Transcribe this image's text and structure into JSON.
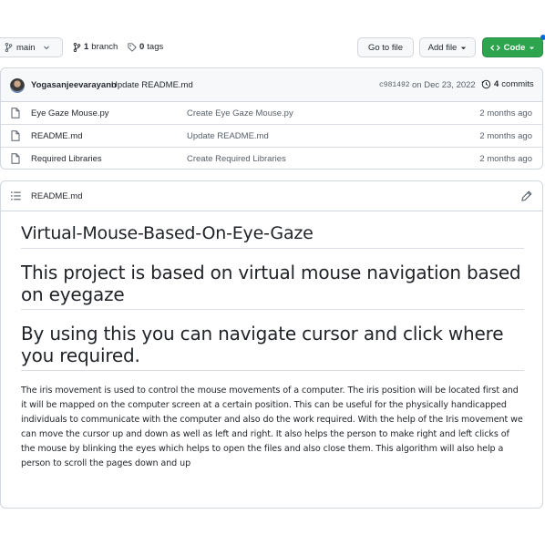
{
  "toolbar": {
    "branch_button": "main",
    "branches_count": "1",
    "branches_label": "branch",
    "tags_count": "0",
    "tags_label": "tags",
    "go_to_file": "Go to file",
    "add_file": "Add file",
    "code": "Code",
    "accent_color": "#2da44e"
  },
  "commit": {
    "author": "Yogasanjeevarayann",
    "message": "Update README.md",
    "hash": "c981492",
    "date": "on Dec 23, 2022",
    "count_number": "4",
    "count_label": "commits"
  },
  "files": [
    {
      "name": "Eye Gaze Mouse.py",
      "commit": "Create Eye Gaze Mouse.py",
      "age": "2 months ago",
      "icon": "file-icon"
    },
    {
      "name": "README.md",
      "commit": "Update README.md",
      "age": "2 months ago",
      "icon": "file-icon"
    },
    {
      "name": "Required Libraries",
      "commit": "Create Required Libraries",
      "age": "2 months ago",
      "icon": "file-icon"
    }
  ],
  "readme": {
    "label": "README.md",
    "headings": [
      "Virtual-Mouse-Based-On-Eye-Gaze",
      "This project is based on virtual mouse navigation based on eyegaze",
      "By using this you can navigate cursor and click where you required."
    ],
    "paragraph": "The iris movement is used to control the mouse movements of a computer. The iris position will be located first and it will be mapped on the computer screen at a certain position. This can be useful for the physically handicapped individuals to communicate with the computer and also do the work required. With the help of the Iris movement we can move the cursor up and down as well as left and right. It also helps the person to make right and left clicks of the mouse by blinking the eyes which helps to open the files and also close them. This algorithm will also help a person to scroll the pages down and up"
  }
}
